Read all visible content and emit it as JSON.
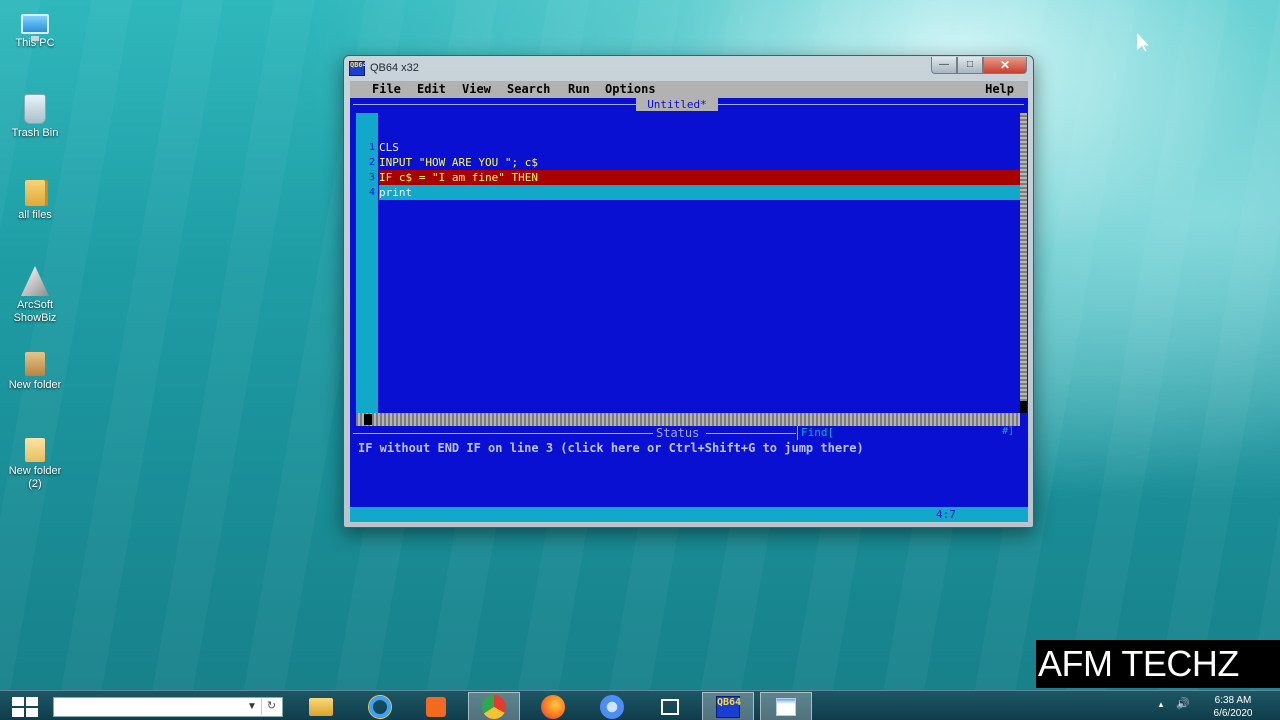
{
  "desktop": {
    "icons": [
      {
        "label": "This PC",
        "icon": "computer-icon"
      },
      {
        "label": "Trash Bin",
        "icon": "recycle-bin-icon"
      },
      {
        "label": "all files",
        "icon": "folder-icon"
      },
      {
        "label": "ArcSoft ShowBiz",
        "icon": "arcsoft-icon"
      },
      {
        "label": "New folder",
        "icon": "folder-icon"
      },
      {
        "label": "New folder (2)",
        "icon": "folder-icon"
      }
    ]
  },
  "window": {
    "title": "QB64 x32",
    "app_icon_text": "QB64",
    "buttons": {
      "minimize": "—",
      "maximize": "□",
      "close": "✕"
    }
  },
  "ide": {
    "menu": [
      "File",
      "Edit",
      "View",
      "Search",
      "Run",
      "Options"
    ],
    "help": "Help",
    "doc_title": "Untitled*",
    "lines": [
      {
        "num": "1",
        "code": "CLS"
      },
      {
        "num": "2",
        "code": "INPUT \"HOW ARE YOU \"; c$"
      },
      {
        "num": "3",
        "code": "IF c$ = \"I am fine\" THEN"
      },
      {
        "num": "4",
        "code": "print"
      }
    ],
    "status_label": "Status",
    "find_label": "Find[",
    "find_counter": "#]",
    "status_message": "IF without END IF on line 3 (click here or Ctrl+Shift+G to jump there)",
    "cursor_position": "4:7",
    "colors": {
      "background": "#0a10d2",
      "error_line": "#a80000",
      "current_line": "#12a8c9",
      "menubar": "#b2b2b2"
    }
  },
  "watermark": "AFM TECHZ",
  "taskbar": {
    "apps": [
      "file-explorer-icon",
      "internet-explorer-icon",
      "media-player-icon",
      "chrome-icon",
      "firefox-icon",
      "chromium-icon",
      "task-view-icon",
      "qb64-icon",
      "notepad-icon"
    ],
    "active_app": "qb64-icon",
    "tray": {
      "show_hidden": "▲",
      "volume": "🔊"
    },
    "clock": {
      "time": "6:38 AM",
      "date": "6/6/2020"
    }
  }
}
